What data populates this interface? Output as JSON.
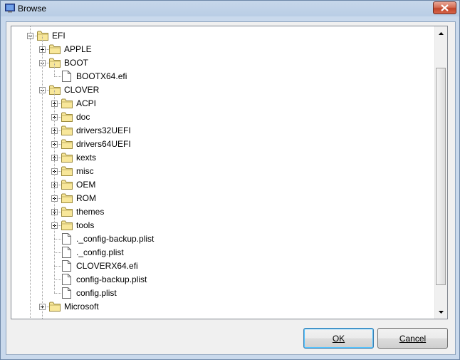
{
  "window": {
    "title": "Browse"
  },
  "tree": {
    "nodes": [
      {
        "label": "EFI",
        "type": "folder",
        "level": 0,
        "expander": "minus"
      },
      {
        "label": "APPLE",
        "type": "folder",
        "level": 1,
        "expander": "plus"
      },
      {
        "label": "BOOT",
        "type": "folder",
        "level": 1,
        "expander": "minus"
      },
      {
        "label": "BOOTX64.efi",
        "type": "file",
        "level": 2,
        "expander": "none"
      },
      {
        "label": "CLOVER",
        "type": "folder",
        "level": 1,
        "expander": "minus"
      },
      {
        "label": "ACPI",
        "type": "folder",
        "level": 2,
        "expander": "plus"
      },
      {
        "label": "doc",
        "type": "folder",
        "level": 2,
        "expander": "plus"
      },
      {
        "label": "drivers32UEFI",
        "type": "folder",
        "level": 2,
        "expander": "plus"
      },
      {
        "label": "drivers64UEFI",
        "type": "folder",
        "level": 2,
        "expander": "plus"
      },
      {
        "label": "kexts",
        "type": "folder",
        "level": 2,
        "expander": "plus"
      },
      {
        "label": "misc",
        "type": "folder",
        "level": 2,
        "expander": "plus"
      },
      {
        "label": "OEM",
        "type": "folder",
        "level": 2,
        "expander": "plus"
      },
      {
        "label": "ROM",
        "type": "folder",
        "level": 2,
        "expander": "plus"
      },
      {
        "label": "themes",
        "type": "folder",
        "level": 2,
        "expander": "plus"
      },
      {
        "label": "tools",
        "type": "folder",
        "level": 2,
        "expander": "plus"
      },
      {
        "label": "._config-backup.plist",
        "type": "file",
        "level": 2,
        "expander": "none"
      },
      {
        "label": "._config.plist",
        "type": "file",
        "level": 2,
        "expander": "none"
      },
      {
        "label": "CLOVERX64.efi",
        "type": "file",
        "level": 2,
        "expander": "none"
      },
      {
        "label": "config-backup.plist",
        "type": "file",
        "level": 2,
        "expander": "none"
      },
      {
        "label": "config.plist",
        "type": "file",
        "level": 2,
        "expander": "none"
      },
      {
        "label": "Microsoft",
        "type": "folder",
        "level": 1,
        "expander": "plus"
      }
    ]
  },
  "buttons": {
    "ok": "OK",
    "cancel": "Cancel"
  },
  "colors": {
    "folder_fill": "#f8e79a",
    "folder_stroke": "#9c8a3c",
    "close_red": "#c94a30"
  }
}
